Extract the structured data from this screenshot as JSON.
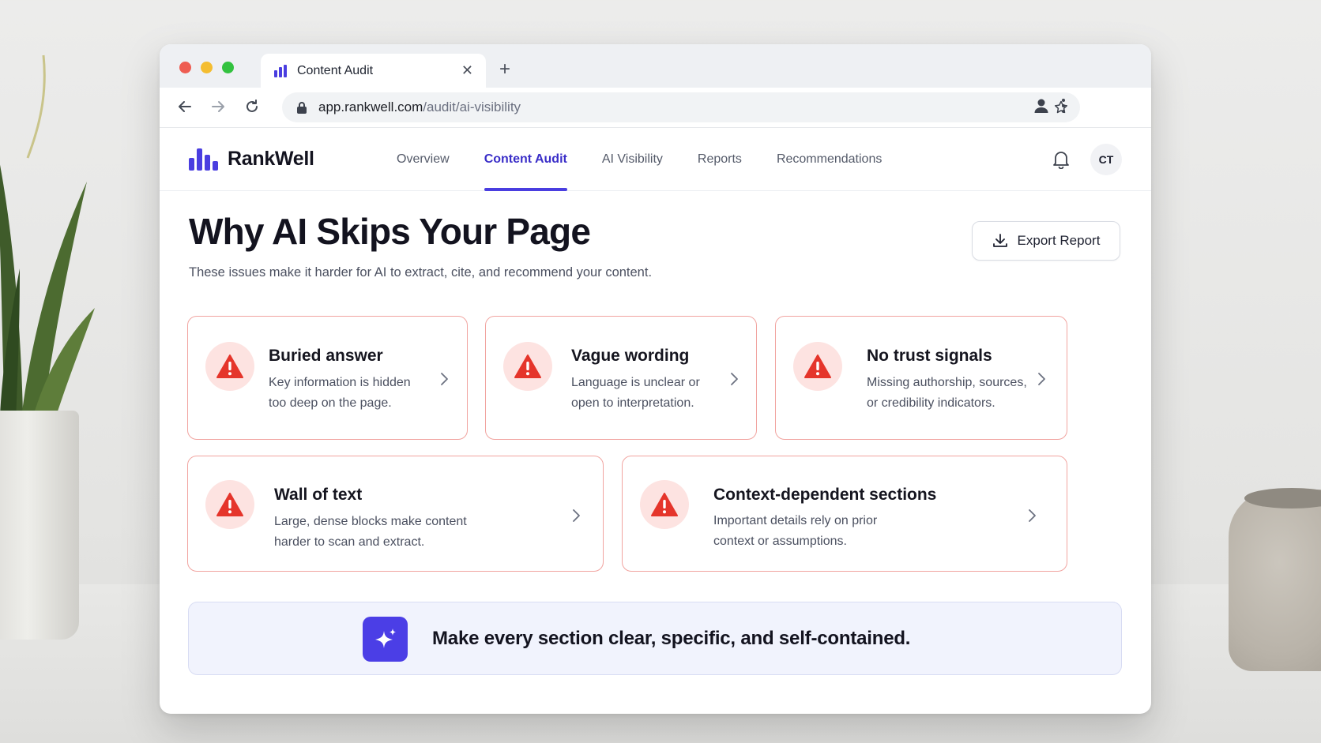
{
  "browser": {
    "tab_title": "Content Audit",
    "url_domain": "app.rankwell.com",
    "url_path": "/audit/ai-visibility"
  },
  "app": {
    "brand": "RankWell",
    "accent": "#4a3ee0",
    "nav": [
      {
        "label": "Overview"
      },
      {
        "label": "Content Audit",
        "active": true
      },
      {
        "label": "AI Visibility"
      },
      {
        "label": "Reports"
      },
      {
        "label": "Recommendations"
      }
    ],
    "avatar_initials": "CT"
  },
  "page": {
    "title": "Why AI Skips Your Page",
    "subtitle": "These issues make it harder for AI to extract, cite, and recommend your content.",
    "export_label": "Export Report"
  },
  "issues": [
    {
      "title": "Buried answer",
      "desc_line1": "Key information is hidden",
      "desc_line2": "too deep on the page.",
      "icon": "warning-icon"
    },
    {
      "title": "Vague wording",
      "desc_line1": "Language is unclear or",
      "desc_line2": "open to interpretation.",
      "icon": "warning-icon"
    },
    {
      "title": "No trust signals",
      "desc_line1": "Missing authorship, sources,",
      "desc_line2": "or credibility indicators.",
      "icon": "warning-icon"
    },
    {
      "title": "Wall of text",
      "desc_line1": "Large, dense blocks make content",
      "desc_line2": "harder to scan and extract.",
      "icon": "warning-icon"
    },
    {
      "title": "Context-dependent sections",
      "desc_line1": "Important details rely on prior",
      "desc_line2": "context or assumptions.",
      "icon": "warning-icon"
    }
  ],
  "tip": {
    "text": "Make every section clear, specific, and self-contained.",
    "icon": "sparkle-icon"
  },
  "colors": {
    "warning": "#e5352b",
    "card_border": "#f1a4a0",
    "tip_bg": "#f1f3fd"
  }
}
